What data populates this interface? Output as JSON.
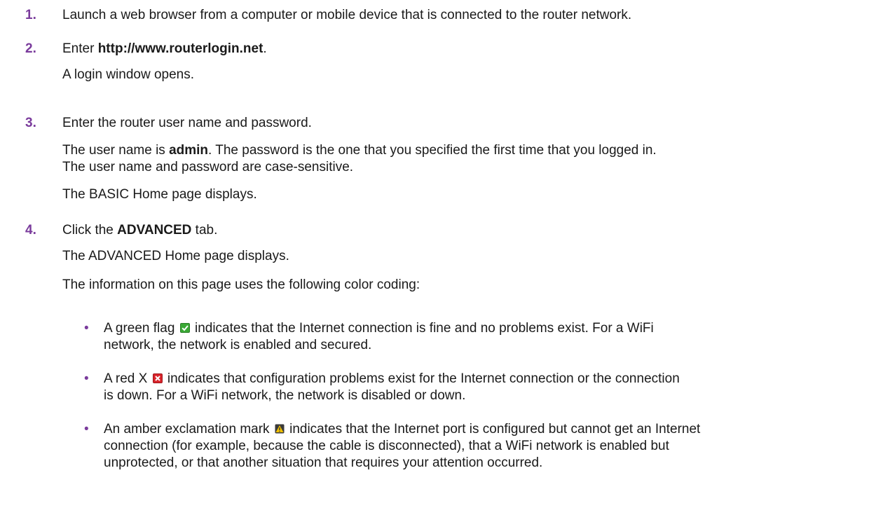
{
  "steps": [
    {
      "num": "1.",
      "line1": "Launch a web browser from a computer or mobile device that is connected to the router network."
    },
    {
      "num": "2.",
      "prefix": "Enter ",
      "url": "http://www.routerlogin.net",
      "suffix": ".",
      "result": "A login window opens."
    },
    {
      "num": "3.",
      "line1": "Enter the router user name and password.",
      "detail_prefix": "The user name is ",
      "detail_bold": "admin",
      "detail_suffix": ". The password is the one that you specified the first time that you logged in.",
      "detail_line2": "The user name and password are case-sensitive.",
      "result": "The BASIC Home page displays."
    },
    {
      "num": "4.",
      "prefix": "Click the ",
      "bold": "ADVANCED",
      "suffix": " tab.",
      "result": "The ADVANCED Home page displays.",
      "intro": "The information on this page uses the following color coding:"
    }
  ],
  "bullets": [
    {
      "bullet": "•",
      "icon": "green-flag-icon",
      "pre": "A green flag ",
      "line1_post": " indicates that the Internet connection is fine and no problems exist. For a WiFi",
      "line2": "network, the network is enabled and secured."
    },
    {
      "bullet": "•",
      "icon": "red-x-icon",
      "pre": "A red X ",
      "line1_post": " indicates that configuration problems exist for the Internet connection or the connection",
      "line2": "is down. For a WiFi network, the network is disabled or down."
    },
    {
      "bullet": "•",
      "icon": "amber-exclamation-icon",
      "pre": "An amber exclamation mark ",
      "line1_post": " indicates that the Internet port is configured but cannot get an Internet",
      "line2": "connection (for example, because the cable is disconnected), that a WiFi network is enabled but",
      "line3": "unprotected, or that another situation that requires your attention occurred."
    }
  ],
  "colors": {
    "accent": "#7a3b9c",
    "green": "#3aa935",
    "red": "#d9242b",
    "amber": "#f2c200"
  }
}
